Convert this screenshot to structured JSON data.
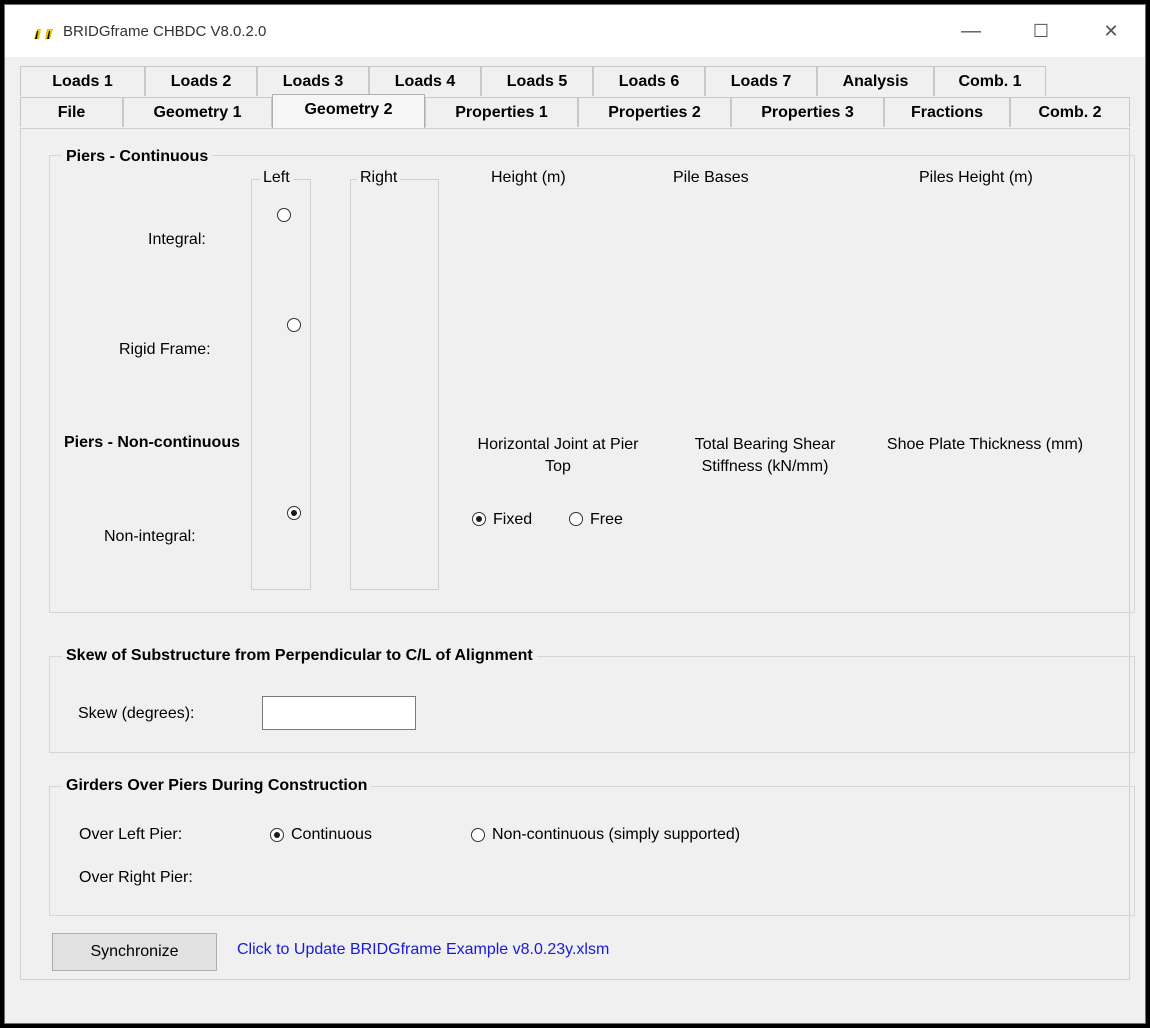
{
  "window": {
    "title": "BRIDGframe CHBDC  V8.0.2.0",
    "minimize": "—",
    "maximize": "☐",
    "close": "✕"
  },
  "tabs_row1": [
    "Loads 1",
    "Loads 2",
    "Loads 3",
    "Loads 4",
    "Loads 5",
    "Loads 6",
    "Loads 7",
    "Analysis",
    "Comb. 1"
  ],
  "tabs_row2": [
    "File",
    "Geometry 1",
    "Geometry 2",
    "Properties 1",
    "Properties 2",
    "Properties 3",
    "Fractions",
    "Comb. 2"
  ],
  "active_tab": "Geometry 2",
  "piers": {
    "title": "Piers - Continuous",
    "left_label": "Left",
    "right_label": "Right",
    "height_label": "Height (m)",
    "pile_bases_label": "Pile Bases",
    "piles_height_label": "Piles Height (m)",
    "integral_label": "Integral:",
    "rigid_frame_label": "Rigid Frame:",
    "noncontinuous_title": "Piers - Non-continuous",
    "non_integral_label": "Non-integral:",
    "horizontal_joint_label": "Horizontal Joint at Pier Top",
    "bearing_stiffness_label": "Total Bearing Shear Stiffness (kN/mm)",
    "shoe_plate_label": "Shoe Plate Thickness (mm)",
    "fixed_label": "Fixed",
    "free_label": "Free",
    "selected_type": "Non-integral",
    "joint_selected": "Fixed"
  },
  "skew": {
    "title": "Skew of Substructure from Perpendicular to C/L of Alignment",
    "label": "Skew (degrees):",
    "value": ""
  },
  "girders": {
    "title": "Girders Over Piers During Construction",
    "over_left_label": "Over Left Pier:",
    "over_right_label": "Over Right Pier:",
    "continuous_label": "Continuous",
    "noncontinuous_label": "Non-continuous (simply supported)",
    "selected": "Continuous"
  },
  "footer": {
    "sync_button": "Synchronize",
    "update_link": "Click to Update BRIDGframe Example v8.0.23y.xlsm"
  }
}
